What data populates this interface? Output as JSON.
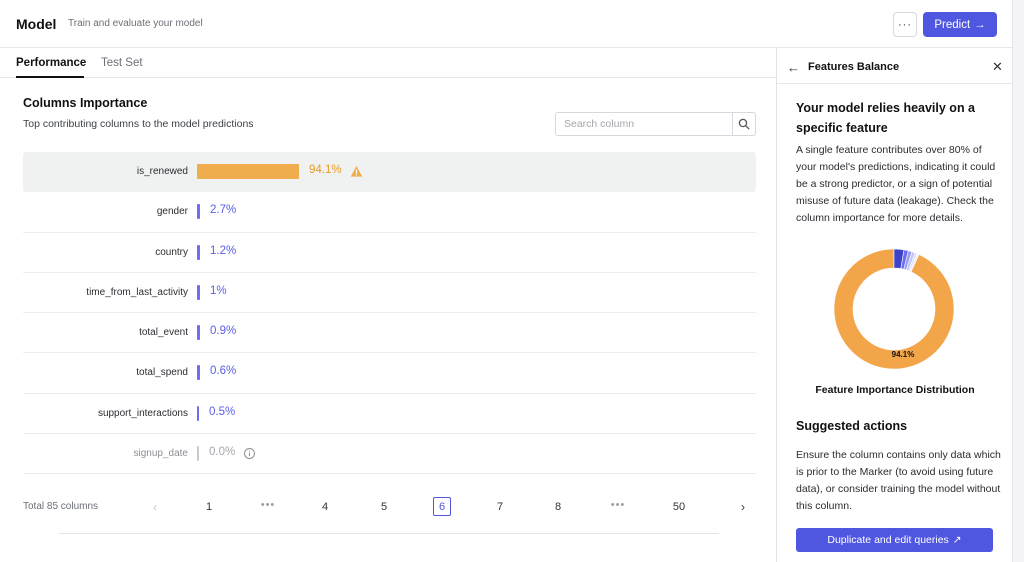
{
  "header": {
    "title": "Model",
    "subtitle": "Train and evaluate your model",
    "more_label": "···",
    "predict_label": "Predict",
    "predict_icon": "arrow-right-icon"
  },
  "tabs": [
    {
      "label": "Performance",
      "active": true
    },
    {
      "label": "Test Set",
      "active": false
    }
  ],
  "importance": {
    "title": "Columns Importance",
    "subtitle": "Top contributing columns to the model predictions",
    "search_placeholder": "Search column",
    "search_icon": "search-icon",
    "rows": [
      {
        "name": "is_renewed",
        "value": 94.1,
        "label": "94.1%",
        "color": "#f0ad4e",
        "icon": "warning-icon",
        "highlight": true
      },
      {
        "name": "gender",
        "value": 2.7,
        "label": "2.7%",
        "color": "#6b6ff0"
      },
      {
        "name": "country",
        "value": 1.2,
        "label": "1.2%",
        "color": "#6b6ff0"
      },
      {
        "name": "time_from_last_activity",
        "value": 1.0,
        "label": "1%",
        "color": "#6b6ff0"
      },
      {
        "name": "total_event",
        "value": 0.9,
        "label": "0.9%",
        "color": "#6b6ff0"
      },
      {
        "name": "total_spend",
        "value": 0.6,
        "label": "0.6%",
        "color": "#6b6ff0"
      },
      {
        "name": "support_interactions",
        "value": 0.5,
        "label": "0.5%",
        "color": "#6b6ff0"
      },
      {
        "name": "signup_date",
        "value": 0.0,
        "label": "0.0%",
        "color": "#c8cacd",
        "icon": "info-icon",
        "muted": true
      }
    ]
  },
  "pagination": {
    "total_label": "Total 85 columns",
    "pages": [
      "1",
      "•••",
      "4",
      "5",
      "6",
      "7",
      "8",
      "•••",
      "50"
    ],
    "current": "6"
  },
  "panel": {
    "title": "Features Balance",
    "heading": "Your model relies heavily on a specific feature",
    "description": "A single feature contributes over 80% of your model's predictions, indicating it could be a strong predictor, or a sign of potential misuse of future data (leakage). Check the column importance for more details.",
    "donut_label": "94.1%",
    "donut_caption": "Feature Importance Distribution",
    "suggest_title": "Suggested actions",
    "suggest_text": "Ensure the column contains only data which is prior to the Marker (to avoid using future data), or consider training the model without this column.",
    "button_label": "Duplicate and edit queries",
    "button_icon": "external-arrow-icon"
  },
  "colors": {
    "accent": "#4f56e0",
    "warning": "#f0ad4e",
    "bar": "#6b6ff0"
  }
}
